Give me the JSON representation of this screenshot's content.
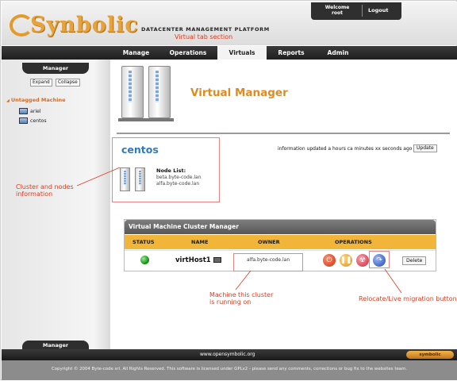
{
  "header": {
    "logo_text": "Synbolic",
    "platform": "DATACENTER MANAGEMENT PLATFORM",
    "welcome": [
      "Welcome",
      "root"
    ],
    "logout": "Logout"
  },
  "annotations": {
    "tab_section": "Virtual tab section",
    "cluster_info": [
      "Cluster and nodes",
      "information"
    ],
    "machine_running": [
      "Machine this cluster",
      "is running on"
    ],
    "relocate": "Relocate/Live migration button"
  },
  "nav": {
    "tabs": [
      "Manage",
      "Operations",
      "Virtuals",
      "Reports",
      "Admin"
    ],
    "active": "Virtuals"
  },
  "sidebar": {
    "header": "Manager",
    "expand": "Expand",
    "collapse": "Collapse",
    "group": "Untagged Machine",
    "items": [
      "ariel",
      "centos"
    ],
    "footer": "Manager"
  },
  "main": {
    "title": "Virtual Manager",
    "cluster_name": "centos",
    "node_list_label": "Node List:",
    "nodes": [
      "beta.byte-code.lan",
      "alfa.byte-code.lan"
    ],
    "info": "information updated a hours ca minutes xx seconds ago",
    "update": "Update"
  },
  "panel": {
    "title": "Virtual Machine Cluster Manager",
    "columns": [
      "STATUS",
      "NAME",
      "OWNER",
      "OPERATIONS"
    ],
    "row": {
      "name": "virtHost1",
      "owner": "alfa.byte-code.lan"
    },
    "delete": "Delete",
    "colors": {
      "header": "#f0b539",
      "status_ok": "#1a9a1a"
    }
  },
  "footer": {
    "url": "www.opensymbolic.org",
    "logo": "symbolic",
    "copyright": "Copyright © 2004 Byte-code srl. All Rights Reserved. This software is licensed under GPLv2 - please send any comments, corrections or bug fix to the websites team."
  },
  "icons": [
    "server-icon",
    "monitor-icon",
    "power-icon",
    "pause-icon",
    "radiation-icon",
    "migrate-icon"
  ]
}
